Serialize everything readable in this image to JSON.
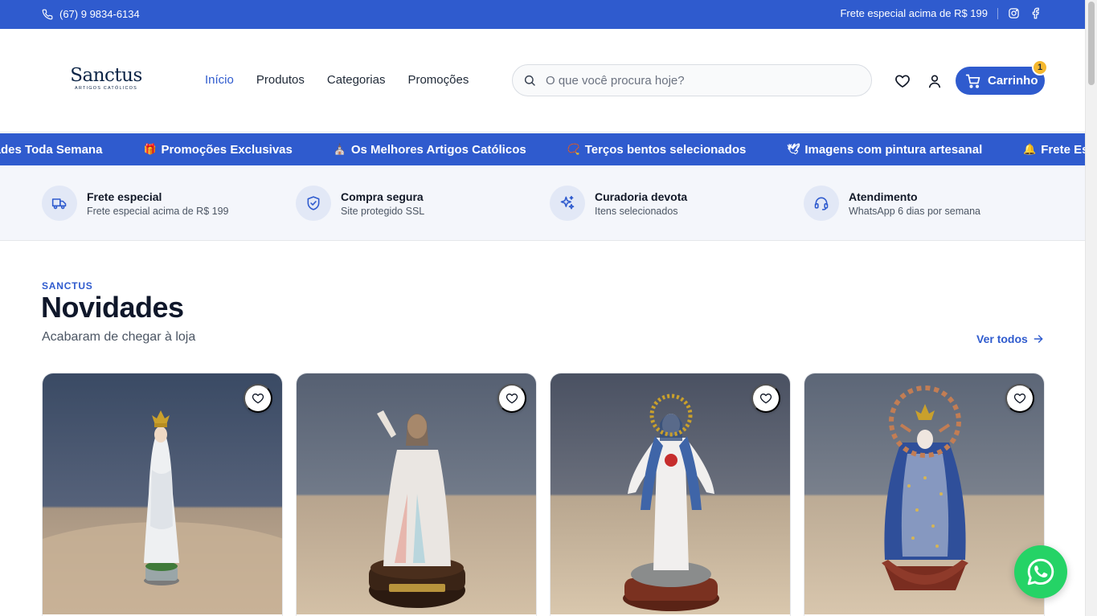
{
  "topbar": {
    "phone": "(67) 9 9834-6134",
    "shipping_notice": "Frete especial acima de R$ 199",
    "phone_icon": "phone-icon",
    "social_icons": [
      "instagram-icon",
      "facebook-icon"
    ]
  },
  "header": {
    "logo_word": "Sanctus",
    "logo_sub": "ARTIGOS CATÓLICOS",
    "nav": [
      {
        "label": "Início",
        "active": true
      },
      {
        "label": "Produtos",
        "active": false
      },
      {
        "label": "Categorias",
        "active": false
      },
      {
        "label": "Promoções",
        "active": false
      }
    ],
    "search_placeholder": "O que você procura hoje?",
    "cart_label": "Carrinho",
    "cart_count": "1",
    "accent_color": "#2f5bce"
  },
  "marquee": [
    {
      "icon": "sparkle-icon",
      "text": "Novidades Toda Semana"
    },
    {
      "icon": "gift-icon",
      "text": "Promoções Exclusivas"
    },
    {
      "icon": "church-icon",
      "text": "Os Melhores Artigos Católicos"
    },
    {
      "icon": "rosary-icon",
      "text": "Terços bentos selecionados"
    },
    {
      "icon": "dove-icon",
      "text": "Imagens com pintura artesanal"
    },
    {
      "icon": "bell-icon",
      "text": "Frete Especial"
    }
  ],
  "features": [
    {
      "icon": "truck-icon",
      "title": "Frete especial",
      "subtitle": "Frete especial acima de R$ 199"
    },
    {
      "icon": "shield-check-icon",
      "title": "Compra segura",
      "subtitle": "Site protegido SSL"
    },
    {
      "icon": "sparkles-icon",
      "title": "Curadoria devota",
      "subtitle": "Itens selecionados"
    },
    {
      "icon": "headset-icon",
      "title": "Atendimento",
      "subtitle": "WhatsApp 6 dias por semana"
    }
  ],
  "section": {
    "eyebrow": "SANCTUS",
    "title": "Novidades",
    "subtitle": "Acabaram de chegar à loja",
    "see_all": "Ver todos"
  },
  "products": [
    {
      "image": "statue-our-lady-fatima"
    },
    {
      "image": "statue-divine-mercy"
    },
    {
      "image": "statue-immaculate-heart-mary"
    },
    {
      "image": "statue-our-lady-aparecida"
    }
  ]
}
